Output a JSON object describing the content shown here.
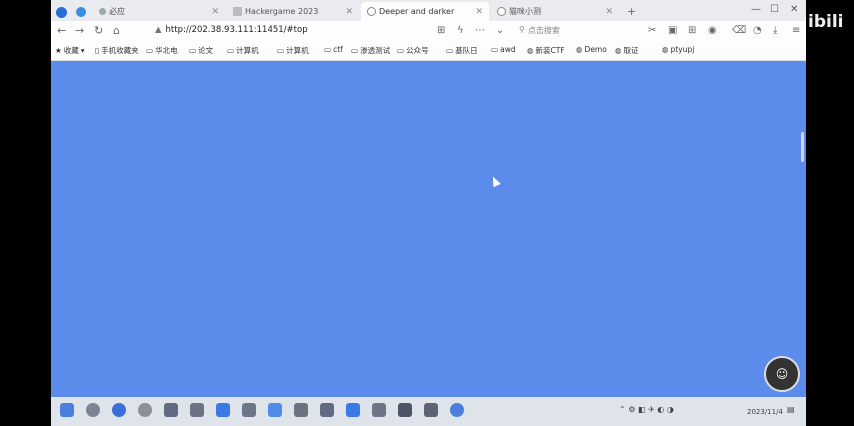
{
  "tabs": [
    {
      "label": "必应",
      "active": false
    },
    {
      "label": "Hackergame 2023",
      "active": false
    },
    {
      "label": "Deeper and darker",
      "active": true
    },
    {
      "label": "猫咪小测",
      "active": false
    }
  ],
  "window_controls": {
    "min": "—",
    "max": "☐",
    "close": "✕"
  },
  "nav": {
    "url": "http://202.38.93.111:11451/#top",
    "search_placeholder": "点击搜索"
  },
  "bookmarks": [
    "收藏",
    "手机收藏夹",
    "华北电",
    "论文",
    "计算机",
    "计算机",
    "ctf",
    "渗透测试",
    "公众号",
    "基队日",
    "awd",
    "新装CTF",
    "Demo",
    "取证",
    "ptyupj"
  ],
  "float_button": {
    "label": "☺"
  },
  "tray": {
    "time": "2023/11/4"
  },
  "watermark": {
    "text": "ibili"
  },
  "colors": {
    "page_bg": "#5b8ceb"
  }
}
